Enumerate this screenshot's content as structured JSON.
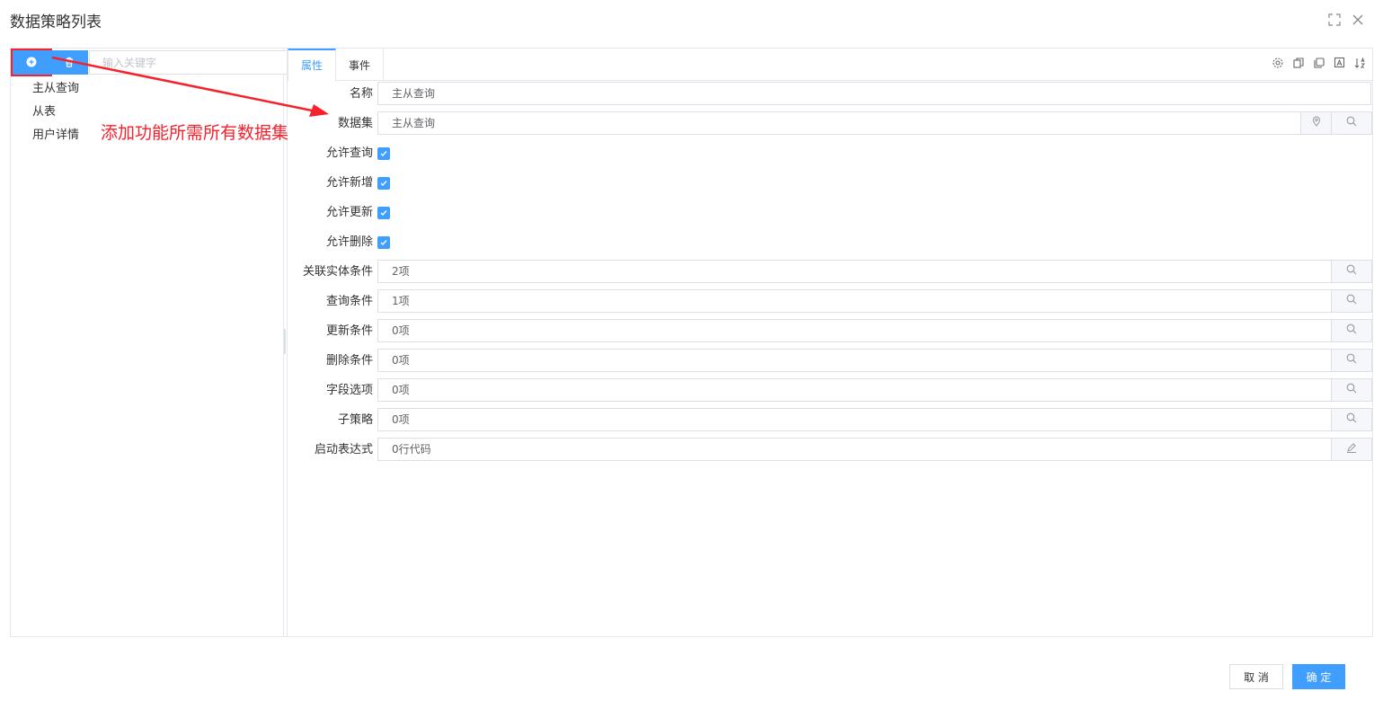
{
  "dialog": {
    "title": "数据策略列表"
  },
  "left": {
    "search_placeholder": "输入关键字",
    "tree": [
      "主从查询",
      "从表",
      "用户详情"
    ]
  },
  "annotation": {
    "text": "添加功能所需所有数据集",
    "color": "#f5222d"
  },
  "tabs": [
    {
      "label": "属性",
      "active": true
    },
    {
      "label": "事件",
      "active": false
    }
  ],
  "form": {
    "name": {
      "label": "名称",
      "value": "主从查询"
    },
    "dataset": {
      "label": "数据集",
      "value": "主从查询"
    },
    "allow_query": {
      "label": "允许查询",
      "checked": true
    },
    "allow_add": {
      "label": "允许新增",
      "checked": true
    },
    "allow_update": {
      "label": "允许更新",
      "checked": true
    },
    "allow_delete": {
      "label": "允许删除",
      "checked": true
    },
    "entity_cond": {
      "label": "关联实体条件",
      "value": "2项"
    },
    "query_cond": {
      "label": "查询条件",
      "value": "1项"
    },
    "update_cond": {
      "label": "更新条件",
      "value": "0项"
    },
    "delete_cond": {
      "label": "删除条件",
      "value": "0项"
    },
    "field_opts": {
      "label": "字段选项",
      "value": "0项"
    },
    "sub_policy": {
      "label": "子策略",
      "value": "0项"
    },
    "startup_expr": {
      "label": "启动表达式",
      "value": "0行代码"
    }
  },
  "footer": {
    "cancel": "取 消",
    "ok": "确 定"
  },
  "colors": {
    "primary": "#409eff",
    "border": "#dcdfe6",
    "highlight": "#f5222d"
  }
}
